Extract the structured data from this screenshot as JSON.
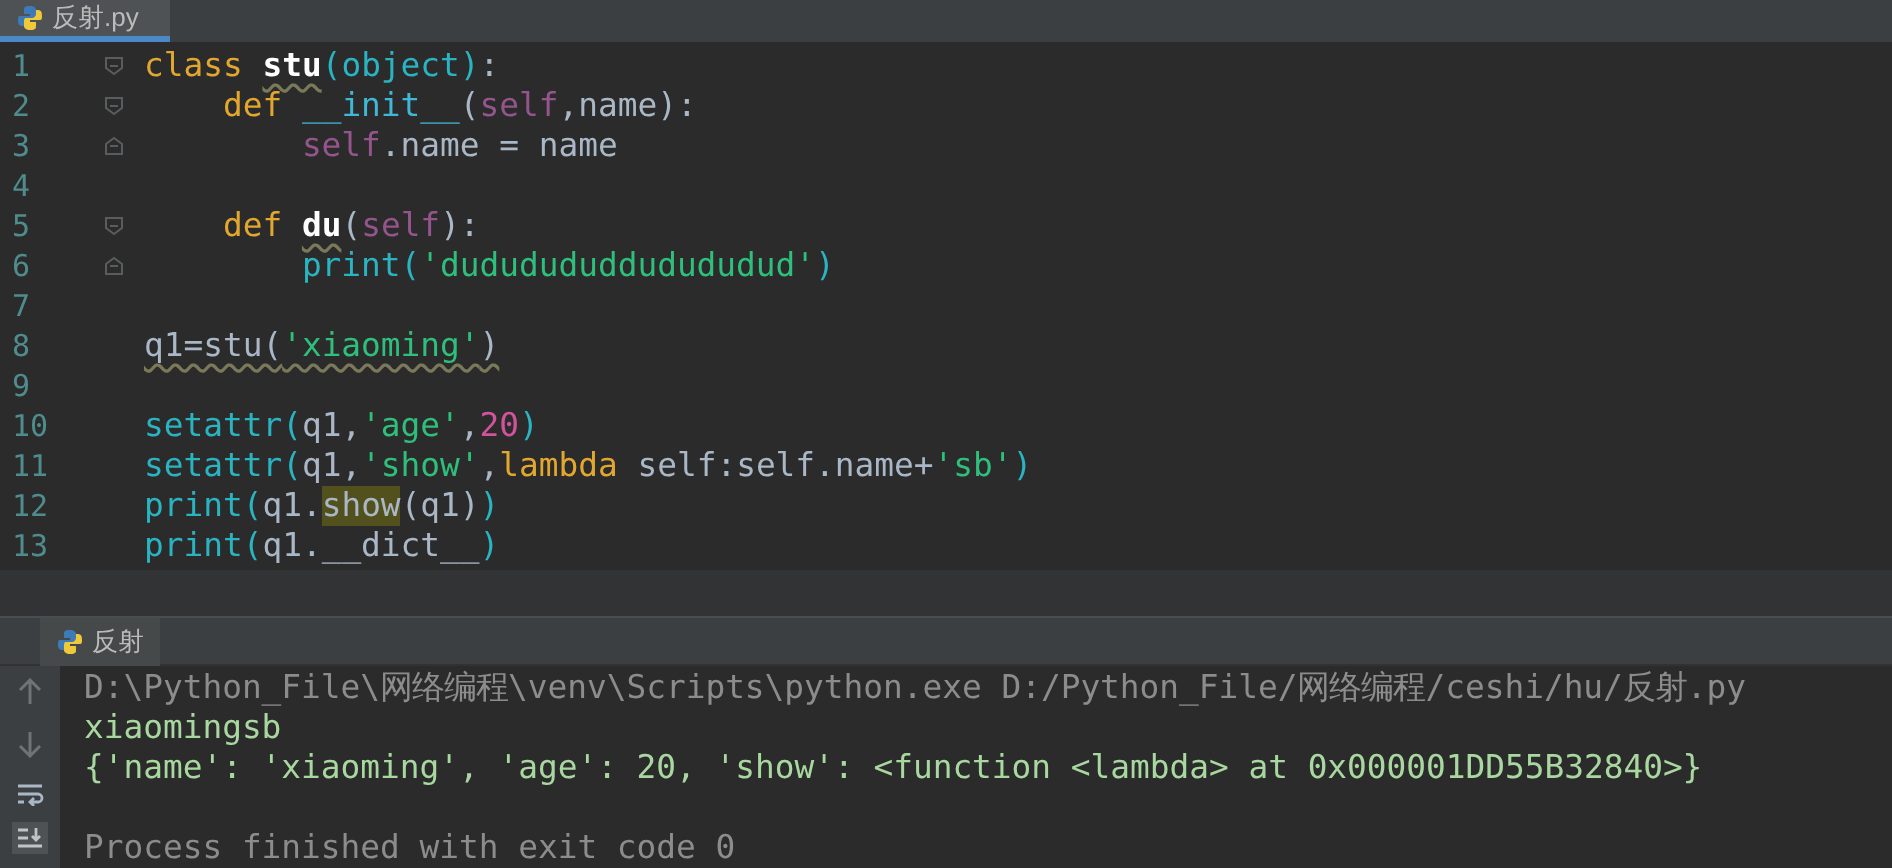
{
  "editor_tab": {
    "label": "反射.py",
    "selected": true
  },
  "code_lines": [
    {
      "number": "1",
      "fold_open": true,
      "fold_close": false,
      "tokens": [
        {
          "kind": "keyword",
          "text": "class "
        },
        {
          "kind": "classname",
          "text": "stu",
          "warn": true
        },
        {
          "kind": "builtin",
          "text": "(object)"
        },
        {
          "kind": "plain",
          "text": ":"
        }
      ]
    },
    {
      "number": "2",
      "fold_open": true,
      "fold_close": false,
      "tokens": [
        {
          "kind": "keyword",
          "text": "    def "
        },
        {
          "kind": "dunder",
          "text": "__init__"
        },
        {
          "kind": "plain",
          "text": "("
        },
        {
          "kind": "self",
          "text": "self"
        },
        {
          "kind": "plain",
          "text": ",name):"
        }
      ]
    },
    {
      "number": "3",
      "fold_open": false,
      "fold_close": true,
      "tokens": [
        {
          "kind": "self",
          "text": "        self"
        },
        {
          "kind": "plain",
          "text": ".name = name"
        }
      ]
    },
    {
      "number": "4",
      "fold_open": false,
      "fold_close": false
    },
    {
      "number": "5",
      "fold_open": true,
      "fold_close": false,
      "tokens": [
        {
          "kind": "keyword",
          "text": "    def "
        },
        {
          "kind": "classname",
          "text": "du",
          "warn": true
        },
        {
          "kind": "plain",
          "text": "("
        },
        {
          "kind": "self",
          "text": "self"
        },
        {
          "kind": "plain",
          "text": "):"
        }
      ]
    },
    {
      "number": "6",
      "fold_open": false,
      "fold_close": true,
      "tokens": [
        {
          "kind": "builtin",
          "text": "        print("
        },
        {
          "kind": "string",
          "text": "'dududududdudududud'"
        },
        {
          "kind": "builtin",
          "text": ")"
        }
      ]
    },
    {
      "number": "7",
      "fold_open": false,
      "fold_close": false
    },
    {
      "number": "8",
      "fold_open": false,
      "fold_close": false,
      "tokens": [
        {
          "kind": "plain",
          "text": "q1=stu(",
          "warn": true
        },
        {
          "kind": "string",
          "text": "'xiaoming'",
          "warn": true
        },
        {
          "kind": "plain",
          "text": ")",
          "warn": true
        }
      ]
    },
    {
      "number": "9",
      "fold_open": false,
      "fold_close": false
    },
    {
      "number": "10",
      "fold_open": false,
      "fold_close": false,
      "tokens": [
        {
          "kind": "builtin",
          "text": "setattr("
        },
        {
          "kind": "plain",
          "text": "q1,"
        },
        {
          "kind": "string",
          "text": "'age'"
        },
        {
          "kind": "plain",
          "text": ","
        },
        {
          "kind": "number",
          "text": "20"
        },
        {
          "kind": "builtin",
          "text": ")"
        }
      ]
    },
    {
      "number": "11",
      "fold_open": false,
      "fold_close": false,
      "tokens": [
        {
          "kind": "builtin",
          "text": "setattr("
        },
        {
          "kind": "plain",
          "text": "q1,"
        },
        {
          "kind": "string",
          "text": "'show'"
        },
        {
          "kind": "plain",
          "text": ","
        },
        {
          "kind": "keyword",
          "text": "lambda "
        },
        {
          "kind": "plain",
          "text": "self:self.name+"
        },
        {
          "kind": "string",
          "text": "'sb'"
        },
        {
          "kind": "builtin",
          "text": ")"
        }
      ]
    },
    {
      "number": "12",
      "fold_open": false,
      "fold_close": false,
      "tokens": [
        {
          "kind": "builtin",
          "text": "print("
        },
        {
          "kind": "plain",
          "text": "q1."
        },
        {
          "kind": "plain",
          "text": "show",
          "highlight": true
        },
        {
          "kind": "plain",
          "text": "(q1)"
        },
        {
          "kind": "builtin",
          "text": ")"
        }
      ]
    },
    {
      "number": "13",
      "fold_open": false,
      "fold_close": false,
      "tokens": [
        {
          "kind": "builtin",
          "text": "print("
        },
        {
          "kind": "plain",
          "text": "q1.__dict__"
        },
        {
          "kind": "builtin",
          "text": ")"
        }
      ]
    }
  ],
  "run_tab": {
    "label": "反射",
    "selected": true
  },
  "console_lines": [
    {
      "kind": "command",
      "text": "D:\\Python_File\\网络编程\\venv\\Scripts\\python.exe D:/Python_File/网络编程/ceshi/hu/反射.py"
    },
    {
      "kind": "output",
      "text": "xiaomingsb"
    },
    {
      "kind": "output",
      "text": "{'name': 'xiaoming', 'age': 20, 'show': <function <lambda> at 0x000001DD55B32840>}"
    },
    {
      "kind": "info",
      "text": "Process finished with exit code 0"
    }
  ]
}
